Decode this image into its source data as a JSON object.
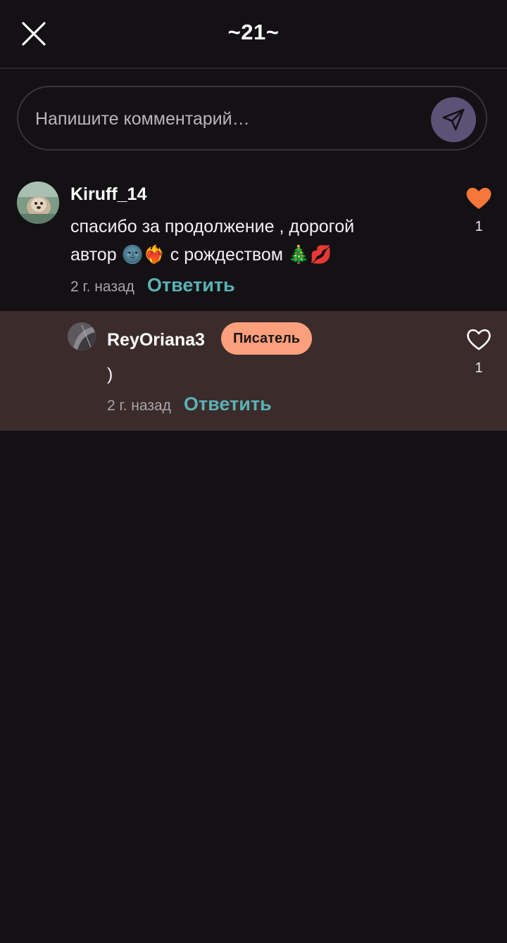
{
  "header": {
    "title": "~21~",
    "close_icon": "close-icon"
  },
  "composer": {
    "placeholder": "Напишите комментарий…",
    "send_icon": "send-icon",
    "send_button_color": "#5a5277"
  },
  "comments": [
    {
      "username": "Kiruff_14",
      "text_line1": "спасибо за продолжение , дорогой",
      "text_line2": "автор 🌚❤️‍🔥 с рождеством 🎄💋",
      "timestamp": "2 г. назад",
      "reply_label": "Ответить",
      "like_count": "1",
      "liked": true,
      "like_color": "#f7773a"
    },
    {
      "username": "ReyOriana3",
      "badge": "Писатель",
      "text": ")",
      "timestamp": "2 г. назад",
      "reply_label": "Ответить",
      "like_count": "1",
      "liked": false,
      "is_reply": true
    }
  ],
  "colors": {
    "background": "#131114",
    "reply_highlight": "#3b2c2b",
    "accent_link": "#5bb1b6",
    "badge": "#fc9f7c"
  }
}
